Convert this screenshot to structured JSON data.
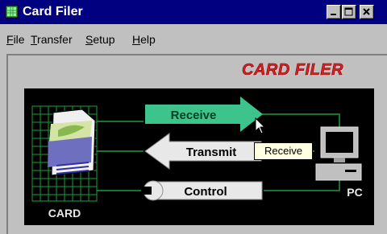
{
  "window": {
    "title": "Card Filer"
  },
  "menu": {
    "items": [
      {
        "mnemonic": "F",
        "rest": "ile"
      },
      {
        "mnemonic": "T",
        "rest": "ransfer"
      },
      {
        "mnemonic": "S",
        "rest": "etup"
      },
      {
        "mnemonic": "H",
        "rest": "elp"
      }
    ]
  },
  "header": {
    "title": "CARD FILER"
  },
  "diagram": {
    "receive_label": "Receive",
    "transmit_label": "Transmit",
    "control_label": "Control",
    "card_label": "CARD",
    "pc_label": "PC"
  },
  "tooltip": {
    "text": "Receive"
  },
  "colors": {
    "titlebar": "#000080",
    "receive": "#3cc48c",
    "grid": "#1e9c3c",
    "heading": "#d42222"
  },
  "icons": [
    "app-icon",
    "minimize-icon",
    "maximize-icon",
    "close-icon",
    "memory-card-icon",
    "pc-icon",
    "arrow-cursor-icon"
  ]
}
